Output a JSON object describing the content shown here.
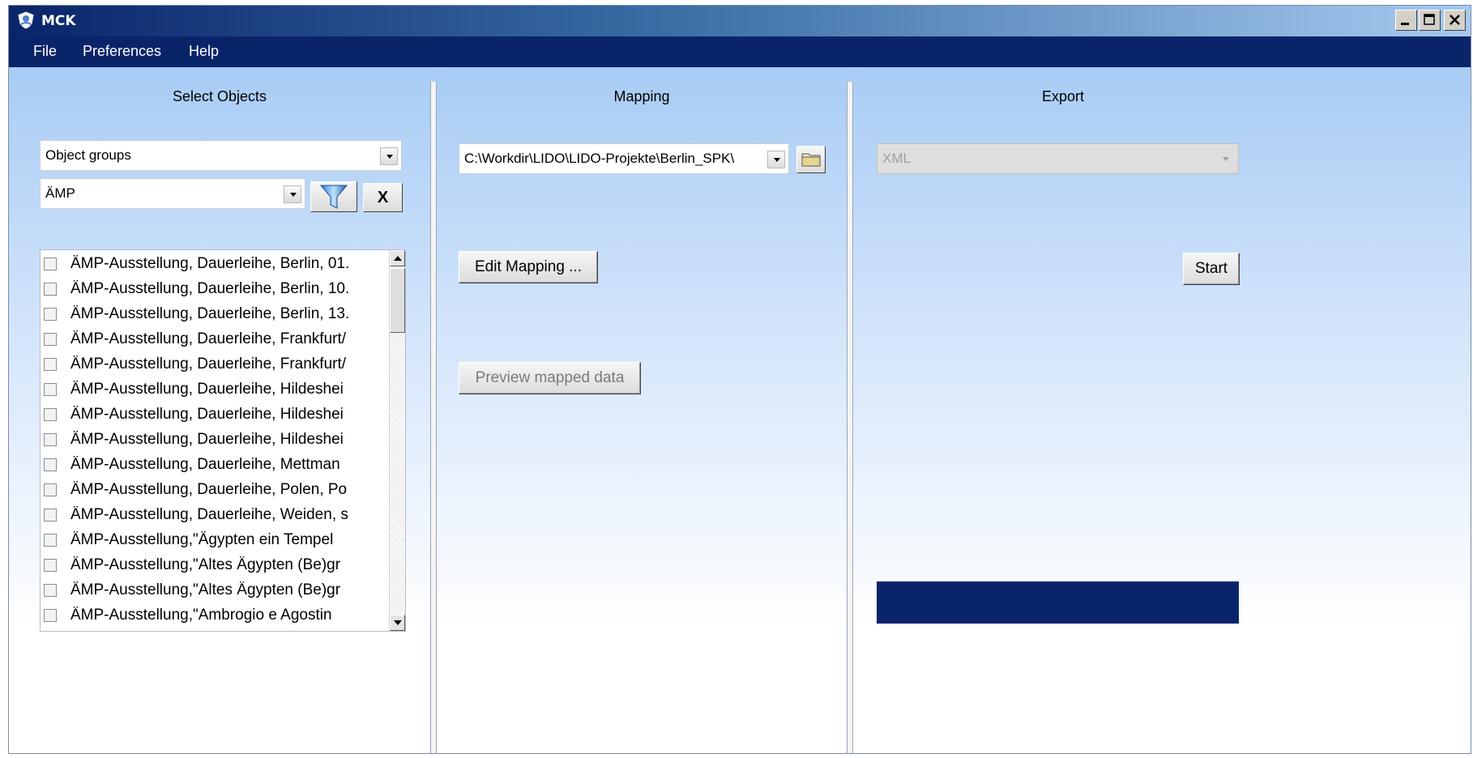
{
  "window": {
    "title": "MCK",
    "icons": {
      "app": "shield-logo-icon",
      "minimize": "minimize-icon",
      "maximize": "maximize-icon",
      "close": "close-icon"
    }
  },
  "menu": {
    "file": "File",
    "preferences": "Preferences",
    "help": "Help"
  },
  "select_objects": {
    "title": "Select Objects",
    "group_combo": "Object groups",
    "group_value_combo": "ÄMP",
    "filter_icon": "funnel-filter-icon",
    "clear_label": "X",
    "items": [
      "ÄMP-Ausstellung,  Dauerleihe,  Berlin, 01.",
      "ÄMP-Ausstellung,  Dauerleihe,  Berlin, 10.",
      "ÄMP-Ausstellung,  Dauerleihe,  Berlin, 13.",
      "ÄMP-Ausstellung,  Dauerleihe, Frankfurt/",
      "ÄMP-Ausstellung,  Dauerleihe, Frankfurt/",
      "ÄMP-Ausstellung,  Dauerleihe, Hildeshei",
      "ÄMP-Ausstellung,  Dauerleihe, Hildeshei",
      "ÄMP-Ausstellung,  Dauerleihe, Hildeshei",
      "ÄMP-Ausstellung,  Dauerleihe, Mettman",
      "ÄMP-Ausstellung, Dauerleihe, Polen, Po",
      "ÄMP-Ausstellung, Dauerleihe, Weiden, s",
      "ÄMP-Ausstellung,\"Ägypten ein Tempel",
      "ÄMP-Ausstellung,\"Altes Ägypten (Be)gr",
      "ÄMP-Ausstellung,\"Altes Ägypten (Be)gr",
      "ÄMP-Ausstellung,\"Ambrogio  e Agostin"
    ]
  },
  "mapping": {
    "title": "Mapping",
    "path": "C:\\Workdir\\LIDO\\LIDO-Projekte\\Berlin_SPK\\",
    "folder_icon": "folder-browse-icon",
    "edit_button": "Edit Mapping ...",
    "preview_button": "Preview mapped data"
  },
  "export": {
    "title": "Export",
    "format": "XML",
    "start_button": "Start",
    "progress": 0
  }
}
